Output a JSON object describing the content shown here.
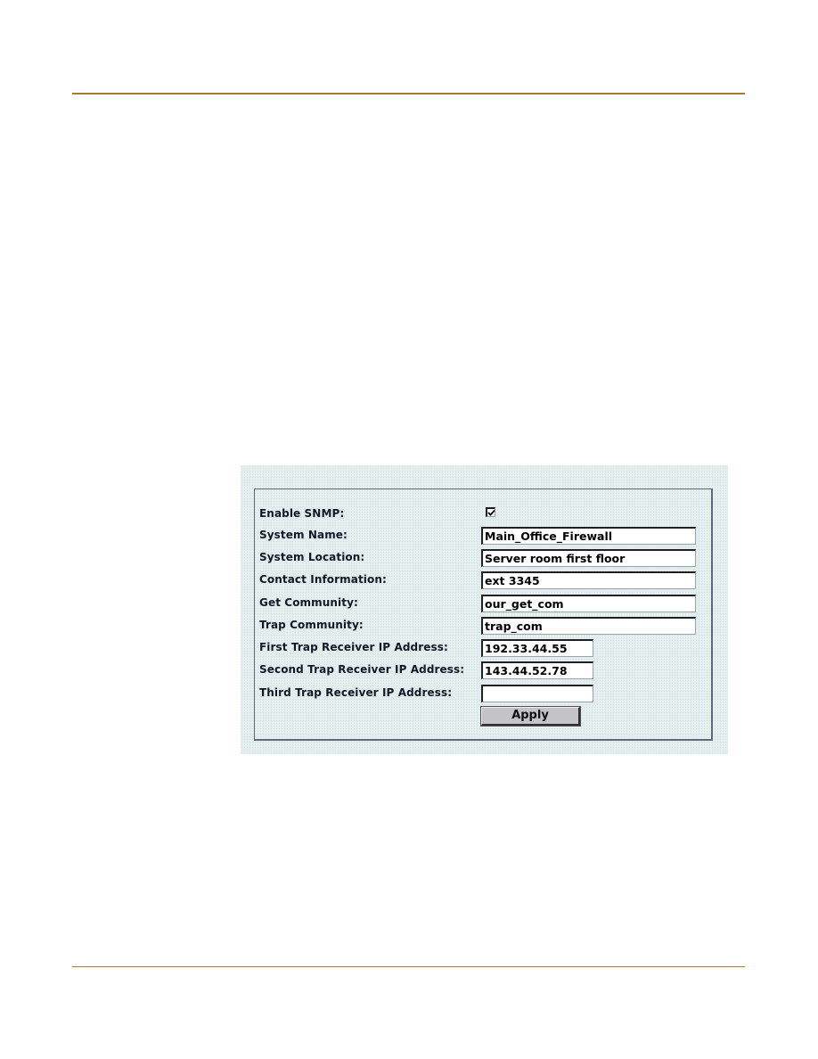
{
  "page": {
    "header_rule_color": "#a57a2a",
    "footer_rule_color": "#b07a2a"
  },
  "snmp_form": {
    "background_color": "#e4eeee",
    "fields": [
      {
        "id": "enable_snmp",
        "label": "Enable SNMP:",
        "type": "checkbox",
        "checked": true
      },
      {
        "id": "system_name",
        "label": "System Name:",
        "type": "text",
        "value": "Main_Office_Firewall"
      },
      {
        "id": "system_location",
        "label": "System Location:",
        "type": "text",
        "value": "Server room first floor"
      },
      {
        "id": "contact_information",
        "label": "Contact Information:",
        "type": "text",
        "value": "ext 3345"
      },
      {
        "id": "get_community",
        "label": "Get Community:",
        "type": "text",
        "value": "our_get_com"
      },
      {
        "id": "trap_community",
        "label": "Trap Community:",
        "type": "text",
        "value": "trap_com"
      },
      {
        "id": "first_trap_receiver_ip",
        "label": "First Trap Receiver IP Address:",
        "type": "text",
        "value": "192.33.44.55"
      },
      {
        "id": "second_trap_receiver_ip",
        "label": "Second Trap Receiver IP Address:",
        "type": "text",
        "value": "143.44.52.78"
      },
      {
        "id": "third_trap_receiver_ip",
        "label": "Third Trap Receiver IP Address:",
        "type": "text",
        "value": ""
      }
    ],
    "apply_label": "Apply"
  }
}
